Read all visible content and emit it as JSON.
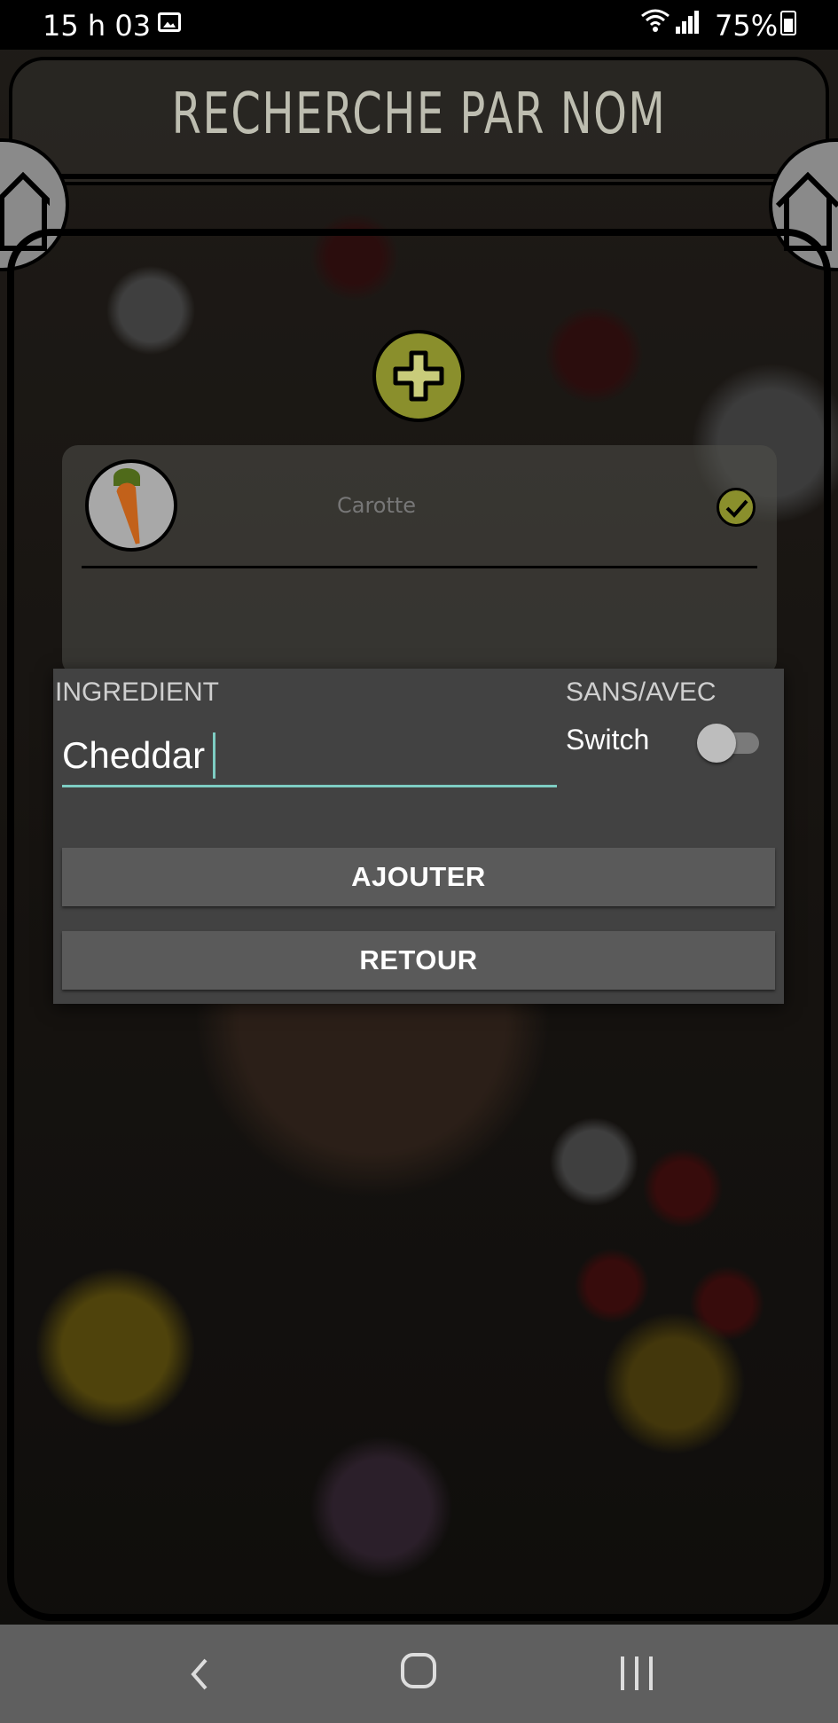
{
  "status_bar": {
    "time": "15 h 03",
    "battery": "75%",
    "icons": [
      "gallery-icon",
      "wifi-icon",
      "signal-icon",
      "battery-icon"
    ]
  },
  "header": {
    "title": "RECHERCHE PAR NOM",
    "left_icon": "home-icon",
    "right_icon": "home-icon"
  },
  "main": {
    "add_icon": "plus-icon",
    "list": [
      {
        "label": "Carotte",
        "image": "carrot",
        "checked": true
      }
    ]
  },
  "dialog": {
    "ingredient_label": "INGREDIENT",
    "ingredient_value": "Cheddar",
    "toggle_label": "SANS/AVEC",
    "switch_label": "Switch",
    "switch_on": false,
    "add_button": "AJOUTER",
    "back_button": "RETOUR"
  },
  "nav_bar": {
    "icons": [
      "back-icon",
      "home-nav-icon",
      "recent-apps-icon"
    ]
  },
  "colors": {
    "accent": "#7ecdc3",
    "olive": "#8a8f2c",
    "dialog_bg": "#424242",
    "button_bg": "#5a5a5a"
  }
}
